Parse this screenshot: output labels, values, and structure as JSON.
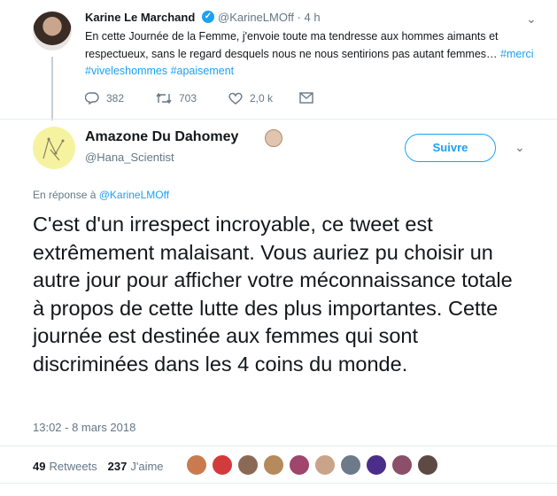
{
  "parent": {
    "name": "Karine Le Marchand",
    "verified_mark": "✓",
    "handle_time": "@KarineLMOff · 4 h",
    "text": "En cette Journée de la Femme, j'envoie toute ma tendresse aux hommes aimants et respectueux, sans le regard desquels nous ne nous sentirions pas autant femmes…",
    "hashtags": "#merci #viveleshommes #apaisement",
    "actions": {
      "replies": "382",
      "retweets": "703",
      "likes": "2,0 k"
    },
    "icons": {
      "reply": "reply-icon",
      "retweet": "retweet-icon",
      "like": "heart-icon",
      "dm": "mail-icon",
      "menu": "chevron-down-icon"
    }
  },
  "main": {
    "name": "Amazone Du Dahomey",
    "handle": "@Hana_Scientist",
    "follow_label": "Suivre",
    "reply_prefix": "En réponse à ",
    "reply_to": "@KarineLMOff",
    "text": "C'est d'un irrespect incroyable, ce tweet est extrêmement malaisant. Vous auriez pu choisir un autre jour pour afficher votre méconnaissance totale à propos de cette lutte des plus importantes. Cette journée est destinée aux femmes qui sont discriminées dans les 4 coins du monde.",
    "timestamp": "13:02 - 8 mars 2018",
    "retweets_count": "49",
    "retweets_label": "Retweets",
    "likes_count": "237",
    "likes_label": "J'aime"
  },
  "colors": {
    "link": "#1da1f2",
    "muted": "#657786",
    "text": "#14171a"
  },
  "liker_colors": [
    "#c97b4f",
    "#d23b3b",
    "#8a6a55",
    "#b58a5c",
    "#a0456b",
    "#caa488",
    "#6c7a89",
    "#4b2d8a",
    "#8b4f6a",
    "#5d4a44"
  ]
}
